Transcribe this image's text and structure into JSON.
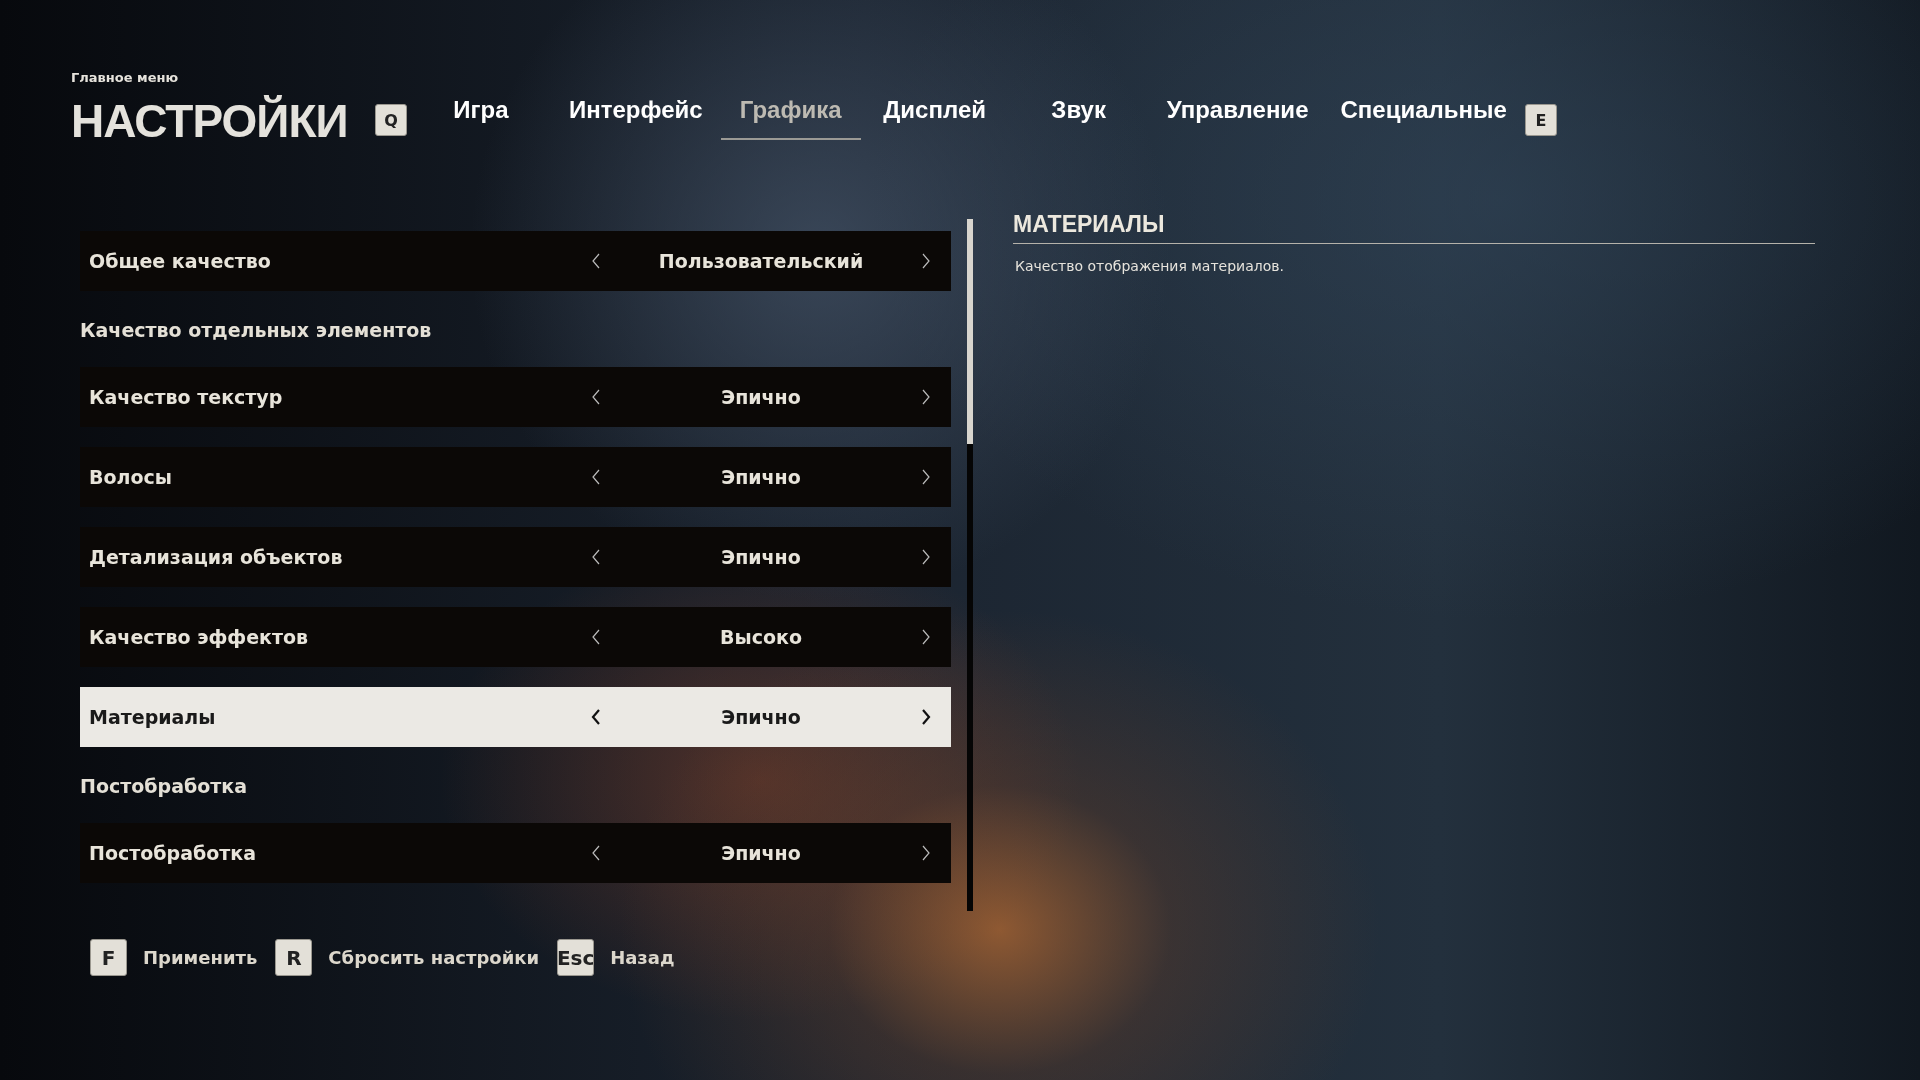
{
  "breadcrumb": "Главное меню",
  "title": "НАСТРОЙКИ",
  "tab_keys": [
    "Q",
    "E"
  ],
  "tabs": [
    {
      "label": "Игра",
      "selected": false
    },
    {
      "label": "Интерфейс",
      "selected": false
    },
    {
      "label": "Графика",
      "selected": true
    },
    {
      "label": "Дисплей",
      "selected": false
    },
    {
      "label": "Звук",
      "selected": false
    },
    {
      "label": "Управление",
      "selected": false
    },
    {
      "label": "Специальные",
      "selected": false
    }
  ],
  "settings": [
    {
      "kind": "setting",
      "label": "Общее качество",
      "value": "Пользовательский",
      "selected": false
    },
    {
      "kind": "section",
      "label": "Качество отдельных элементов"
    },
    {
      "kind": "setting",
      "label": "Качество текстур",
      "value": "Эпично",
      "selected": false
    },
    {
      "kind": "setting",
      "label": "Волосы",
      "value": "Эпично",
      "selected": false
    },
    {
      "kind": "setting",
      "label": "Детализация объектов",
      "value": "Эпично",
      "selected": false
    },
    {
      "kind": "setting",
      "label": "Качество эффектов",
      "value": "Высоко",
      "selected": false
    },
    {
      "kind": "setting",
      "label": "Материалы",
      "value": "Эпично",
      "selected": true
    },
    {
      "kind": "section",
      "label": "Постобработка"
    },
    {
      "kind": "setting",
      "label": "Постобработка",
      "value": "Эпично",
      "selected": false
    }
  ],
  "description": {
    "title": "МАТЕРИАЛЫ",
    "text": "Качество отображения материалов."
  },
  "footer": [
    {
      "key": "F",
      "label": "Применить"
    },
    {
      "key": "R",
      "label": "Сбросить настройки"
    },
    {
      "key": "Esc",
      "label": "Назад"
    }
  ]
}
